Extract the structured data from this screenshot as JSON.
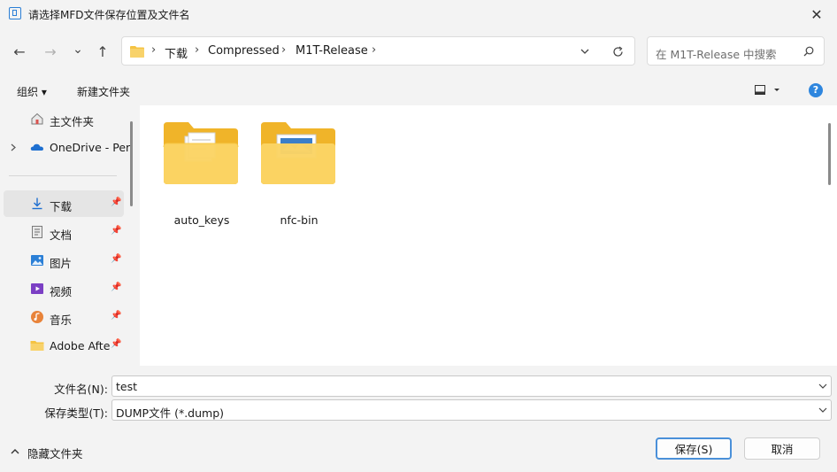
{
  "window": {
    "title": "请选择MFD文件保存位置及文件名",
    "close": "✕"
  },
  "nav": {
    "back": "←",
    "forward": "→",
    "recent": "⌄",
    "up": "↑"
  },
  "address": {
    "crumbs": [
      "下载",
      "Compressed",
      "M1T-Release"
    ],
    "separator": "›"
  },
  "search": {
    "placeholder": "在 M1T-Release 中搜索"
  },
  "toolbar": {
    "organize": "组织 ▾",
    "new_folder": "新建文件夹",
    "help": "?"
  },
  "sidebar": {
    "items": [
      {
        "label": "主文件夹",
        "icon": "home-icon"
      },
      {
        "label": "OneDrive - Per",
        "icon": "onedrive-cloud-icon"
      },
      {
        "label": "下载",
        "icon": "download-icon",
        "pinned": true,
        "selected": true
      },
      {
        "label": "文档",
        "icon": "documents-icon",
        "pinned": true
      },
      {
        "label": "图片",
        "icon": "pictures-icon",
        "pinned": true
      },
      {
        "label": "视频",
        "icon": "videos-icon",
        "pinned": true
      },
      {
        "label": "音乐",
        "icon": "music-icon",
        "pinned": true
      },
      {
        "label": "Adobe After",
        "icon": "folder-icon",
        "pinned": true
      }
    ]
  },
  "files": [
    {
      "name": "auto_keys",
      "type": "folder"
    },
    {
      "name": "nfc-bin",
      "type": "folder"
    }
  ],
  "form": {
    "filename_label": "文件名(N):",
    "filename_value": "test",
    "filetype_label": "保存类型(T):",
    "filetype_value": "DUMP文件 (*.dump)"
  },
  "footer": {
    "hide_folders": "隐藏文件夹",
    "save": "保存(S)",
    "cancel": "取消"
  },
  "colors": {
    "accent": "#2e86de",
    "folder": "#f5c342",
    "selected_bg": "#e5e5e5"
  }
}
